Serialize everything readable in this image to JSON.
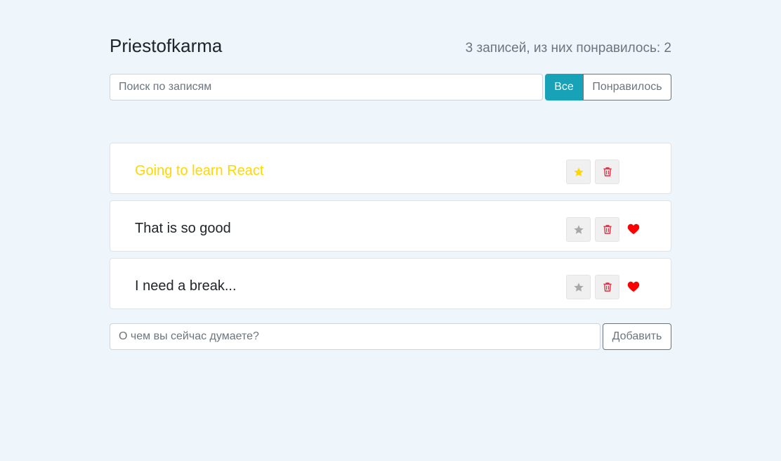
{
  "header": {
    "title": "Priestofkarma",
    "counter": "3 записей, из них понравилось: 2"
  },
  "search": {
    "placeholder": "Поиск по записям",
    "value": ""
  },
  "filters": [
    {
      "label": "Все",
      "active": true
    },
    {
      "label": "Понравилось",
      "active": false
    }
  ],
  "posts": [
    {
      "label": "Going to learn React",
      "important": true,
      "liked": false
    },
    {
      "label": "That is so good",
      "important": false,
      "liked": true
    },
    {
      "label": "I need a break...",
      "important": false,
      "liked": true
    }
  ],
  "add_form": {
    "placeholder": "О чем вы сейчас думаете?",
    "value": "",
    "button_label": "Добавить"
  },
  "icons": {
    "star": "star-icon",
    "trash": "trash-icon",
    "heart": "heart-icon"
  },
  "colors": {
    "background": "#eef5fb",
    "accent": "#17a2b8",
    "important": "#ffd700",
    "star_inactive": "#a8a8a8",
    "trash": "#dc3545",
    "heart": "#ff0000"
  }
}
